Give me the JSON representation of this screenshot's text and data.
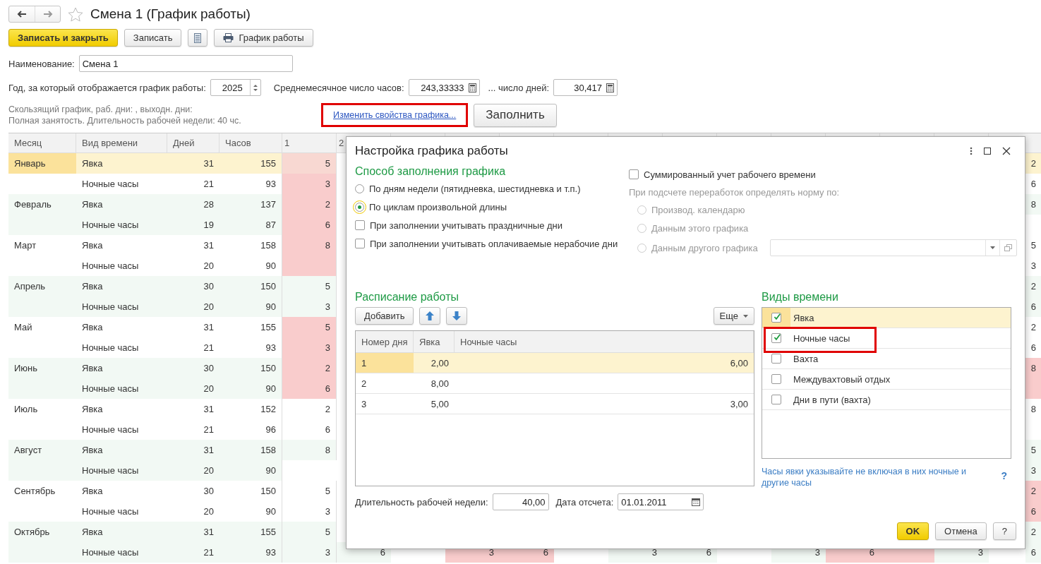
{
  "title": "Смена 1 (График работы)",
  "toolbar": [
    {
      "kind": "primary",
      "label": "Записать и закрыть"
    },
    {
      "kind": "plain",
      "label": "Записать"
    },
    {
      "kind": "list"
    },
    {
      "kind": "print",
      "label": "График работы"
    }
  ],
  "name_field": {
    "label": "Наименование:",
    "value": "Смена 1"
  },
  "year_field": {
    "label": "Год, за который отображается график работы:",
    "value": "2025"
  },
  "avg_hours": {
    "label": "Среднемесячное число часов:",
    "value": "243,33333"
  },
  "avg_days": {
    "label": "... число дней:",
    "value": "30,417"
  },
  "info": [
    "Скользящий график, раб. дни: , выходн. дни:",
    "Полная занятость. Длительность рабочей недели: 40 чс."
  ],
  "change_link": {
    "label": "Изменить свойства графика...",
    "highlighted": true
  },
  "fill_button": "Заполнить",
  "table": {
    "columns": [
      "Месяц",
      "Вид времени",
      "Дней",
      "Часов",
      "1",
      "2"
    ],
    "rows": [
      {
        "month": "Январь",
        "kind_label": "Явка",
        "days": "31",
        "hours": "155",
        "selected": true,
        "day_1": {
          "value": "5",
          "holiday": true
        },
        "day_14": {
          "value": "2",
          "holiday": false
        }
      },
      {
        "kind_label": "Ночные часы",
        "days": "21",
        "hours": "93",
        "selected": false,
        "day_1": {
          "value": "3",
          "holiday": true
        },
        "day_14": {
          "value": "6",
          "holiday": false
        }
      },
      {
        "month": "Февраль",
        "kind_label": "Явка",
        "days": "28",
        "hours": "137",
        "selected": false,
        "day_1": {
          "value": "2",
          "holiday": true
        },
        "day_14": {
          "value": "8",
          "holiday": false
        }
      },
      {
        "kind_label": "Ночные часы",
        "days": "19",
        "hours": "87",
        "selected": false,
        "day_1": {
          "value": "6",
          "holiday": true
        }
      },
      {
        "month": "Март",
        "kind_label": "Явка",
        "days": "31",
        "hours": "158",
        "selected": false,
        "day_1": {
          "value": "8",
          "holiday": true
        },
        "day_14": {
          "value": "5",
          "holiday": false
        }
      },
      {
        "kind_label": "Ночные часы",
        "days": "20",
        "hours": "90",
        "selected": false,
        "day_1": {
          "holiday": true
        },
        "day_14": {
          "value": "3",
          "holiday": false
        }
      },
      {
        "month": "Апрель",
        "kind_label": "Явка",
        "days": "30",
        "hours": "150",
        "selected": false,
        "day_1": {
          "value": "5",
          "holiday": false
        },
        "day_14": {
          "value": "2",
          "holiday": false
        }
      },
      {
        "kind_label": "Ночные часы",
        "days": "20",
        "hours": "90",
        "selected": false,
        "day_1": {
          "value": "3",
          "holiday": false
        },
        "day_14": {
          "value": "6",
          "holiday": false
        }
      },
      {
        "month": "Май",
        "kind_label": "Явка",
        "days": "31",
        "hours": "155",
        "selected": false,
        "day_1": {
          "value": "5",
          "holiday": true
        },
        "day_14": {
          "value": "2",
          "holiday": false
        }
      },
      {
        "kind_label": "Ночные часы",
        "days": "21",
        "hours": "93",
        "selected": false,
        "day_1": {
          "value": "3",
          "holiday": true
        },
        "day_14": {
          "value": "6",
          "holiday": false
        }
      },
      {
        "month": "Июнь",
        "kind_label": "Явка",
        "days": "30",
        "hours": "150",
        "selected": false,
        "day_1": {
          "value": "2",
          "holiday": true
        },
        "day_14": {
          "value": "8",
          "holiday": true
        }
      },
      {
        "kind_label": "Ночные часы",
        "days": "20",
        "hours": "90",
        "selected": false,
        "day_1": {
          "value": "6",
          "holiday": true
        },
        "day_14": {
          "holiday": true
        }
      },
      {
        "month": "Июль",
        "kind_label": "Явка",
        "days": "31",
        "hours": "152",
        "selected": false,
        "day_1": {
          "value": "2",
          "holiday": false
        },
        "day_14": {
          "value": "8",
          "holiday": false
        }
      },
      {
        "kind_label": "Ночные часы",
        "days": "21",
        "hours": "96",
        "selected": false,
        "day_1": {
          "value": "6",
          "holiday": false
        }
      },
      {
        "month": "Август",
        "kind_label": "Явка",
        "days": "31",
        "hours": "158",
        "selected": false,
        "day_1": {
          "value": "8",
          "holiday": false
        },
        "day_14": {
          "value": "5",
          "holiday": false
        }
      },
      {
        "kind_label": "Ночные часы",
        "days": "20",
        "hours": "90",
        "selected": false,
        "day_14": {
          "value": "3",
          "holiday": false
        }
      },
      {
        "month": "Сентябрь",
        "kind_label": "Явка",
        "days": "30",
        "hours": "150",
        "selected": false,
        "day_1": {
          "value": "5",
          "holiday": false
        },
        "day_14": {
          "value": "2",
          "holiday": true
        }
      },
      {
        "kind_label": "Ночные часы",
        "days": "20",
        "hours": "90",
        "selected": false,
        "day_1": {
          "value": "3",
          "holiday": false
        },
        "day_14": {
          "value": "6",
          "holiday": true
        }
      },
      {
        "month": "Октябрь",
        "kind_label": "Явка",
        "days": "31",
        "hours": "155",
        "selected": false,
        "day_1": {
          "value": "5",
          "holiday": false
        },
        "day_14": {
          "value": "2",
          "holiday": false
        }
      },
      {
        "kind_label": "Ночные часы",
        "days": "21",
        "hours": "93",
        "selected": false,
        "day_1": {
          "value": "3",
          "holiday": false
        },
        "day_2": {
          "value": "6",
          "holiday": false
        },
        "day_4": {
          "value": "3",
          "holiday": true
        },
        "day_5": {
          "value": "6",
          "holiday": true
        },
        "day_7": {
          "value": "3",
          "holiday": false
        },
        "day_8": {
          "value": "6",
          "holiday": false
        },
        "day_10": {
          "value": "3",
          "holiday": false
        },
        "day_11": {
          "value": "6",
          "holiday": true
        },
        "day_12": {
          "holiday": true
        },
        "day_13": {
          "value": "3",
          "holiday": false
        },
        "day_14": {
          "value": "6",
          "holiday": false
        }
      }
    ]
  },
  "dialog": {
    "title": "Настройка графика работы",
    "fill_method": {
      "heading": "Способ заполнения графика",
      "options": [
        {
          "label": "По дням недели (пятидневка, шестидневка и т.п.)",
          "selected": false
        },
        {
          "label": "По циклам произвольной длины",
          "selected": true
        }
      ],
      "checks": [
        {
          "label": "При заполнении учитывать праздничные дни",
          "checked": false
        },
        {
          "label": "При заполнении учитывать оплачиваемые нерабочие дни",
          "checked": false
        }
      ]
    },
    "summarized": {
      "label": "Суммированный учет рабочего времени",
      "checked": false
    },
    "norm": {
      "label": "При подсчете переработок определять норму по:",
      "disabled": true,
      "options": [
        {
          "label": "Производ. календарю",
          "selected": false
        },
        {
          "label": "Данным этого графика",
          "selected": false
        },
        {
          "label": "Данным другого графика",
          "selected": false
        }
      ]
    },
    "schedule": {
      "heading": "Расписание работы",
      "add_button": "Добавить",
      "more_button": "Еще",
      "columns": [
        "Номер дня",
        "Явка",
        "Ночные часы"
      ],
      "rows": [
        {
          "day": "1",
          "attendance": "2,00",
          "night": "6,00",
          "selected": true
        },
        {
          "day": "2",
          "attendance": "8,00",
          "selected": false
        },
        {
          "day": "3",
          "attendance": "5,00",
          "night": "3,00",
          "selected": false
        }
      ]
    },
    "week_length": {
      "label": "Длительность рабочей недели:",
      "value": "40,00"
    },
    "start_date": {
      "label": "Дата отсчета:",
      "value": "01.01.2011"
    },
    "time_kinds": {
      "heading": "Виды времени",
      "items": [
        {
          "label": "Явка",
          "checked": true,
          "selected": true,
          "highlighted": false
        },
        {
          "label": "Ночные часы",
          "checked": true,
          "selected": false,
          "highlighted": true
        },
        {
          "label": "Вахта",
          "checked": false,
          "selected": false,
          "highlighted": false
        },
        {
          "label": "Междувахтовый отдых",
          "checked": false,
          "selected": false,
          "highlighted": false
        },
        {
          "label": "Дни в пути (вахта)",
          "checked": false,
          "selected": false,
          "highlighted": false
        }
      ]
    },
    "hint": "Часы явки указывайте не включая в них ночные и другие часы",
    "help_link": "?",
    "buttons": [
      {
        "kind": "primary",
        "label": "OK"
      },
      {
        "kind": "plain",
        "label": "Отмена"
      },
      {
        "kind": "plain",
        "label": "?"
      }
    ]
  }
}
